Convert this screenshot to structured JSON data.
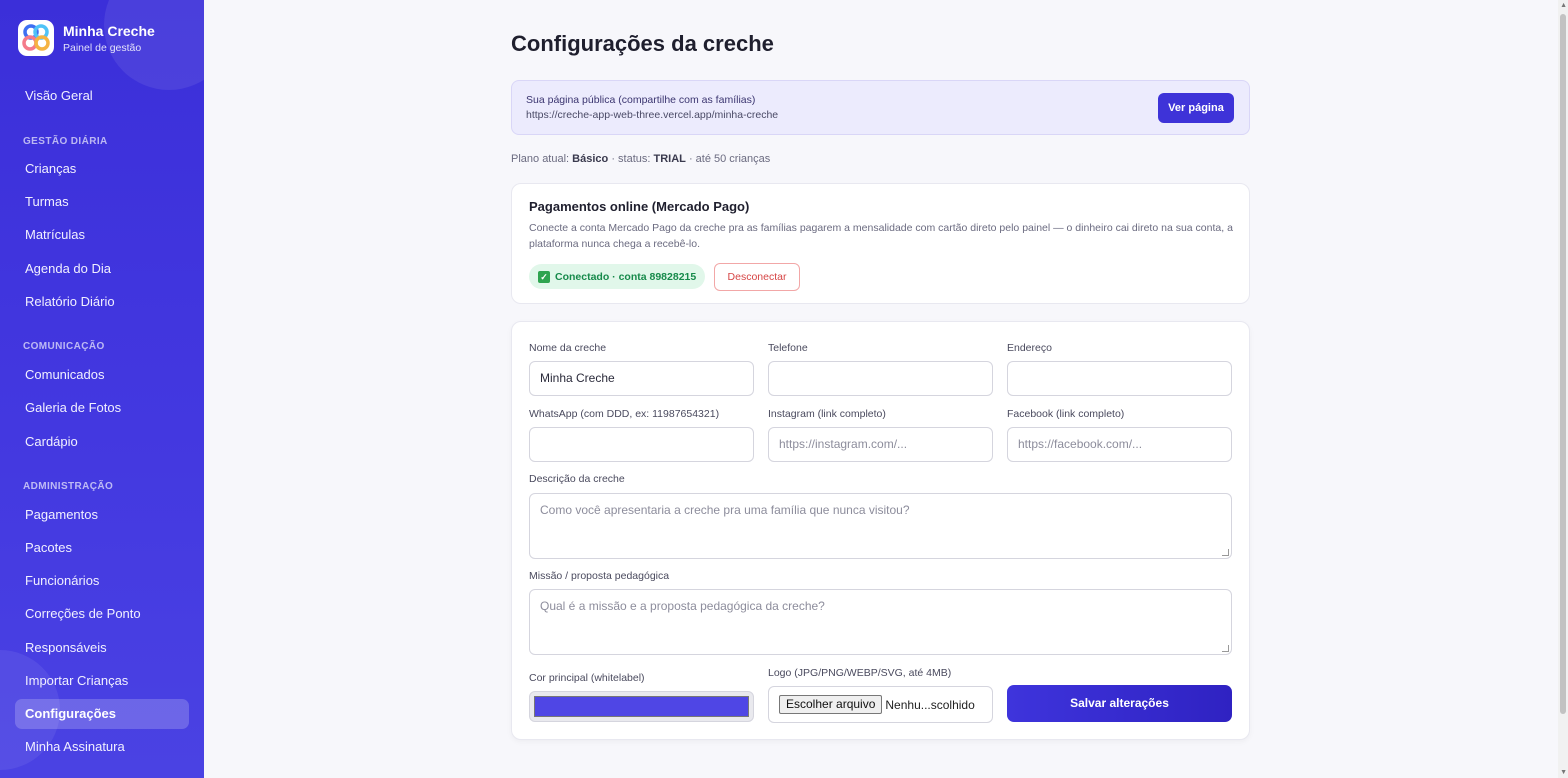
{
  "brand": {
    "name": "Minha Creche",
    "subtitle": "Painel de gestão"
  },
  "nav": {
    "overview": "Visão Geral",
    "section_daily": "GESTÃO DIÁRIA",
    "criancas": "Crianças",
    "turmas": "Turmas",
    "matriculas": "Matrículas",
    "agenda": "Agenda do Dia",
    "relatorio": "Relatório Diário",
    "section_comm": "COMUNICAÇÃO",
    "comunicados": "Comunicados",
    "galeria": "Galeria de Fotos",
    "cardapio": "Cardápio",
    "section_admin": "ADMINISTRAÇÃO",
    "pagamentos": "Pagamentos",
    "pacotes": "Pacotes",
    "funcionarios": "Funcionários",
    "correcoes": "Correções de Ponto",
    "responsaveis": "Responsáveis",
    "importar": "Importar Crianças",
    "configuracoes": "Configurações",
    "assinatura": "Minha Assinatura"
  },
  "page": {
    "title": "Configurações da creche"
  },
  "public_page": {
    "label": "Sua página pública (compartilhe com as famílias)",
    "url": "https://creche-app-web-three.vercel.app/minha-creche",
    "button": "Ver página"
  },
  "plan": {
    "prefix": "Plano atual:",
    "name": "Básico",
    "status_prefix": "· status:",
    "status": "TRIAL",
    "limit": "· até 50 crianças"
  },
  "payments": {
    "title": "Pagamentos online (Mercado Pago)",
    "description": "Conecte a conta Mercado Pago da creche pra as famílias pagarem a mensalidade com cartão direto pelo painel — o dinheiro cai direto na sua conta, a plataforma nunca chega a recebê-lo.",
    "connected": "Conectado · conta 89828215",
    "disconnect": "Desconectar"
  },
  "form": {
    "nome_label": "Nome da creche",
    "nome_value": "Minha Creche",
    "telefone_label": "Telefone",
    "telefone_value": "",
    "endereco_label": "Endereço",
    "endereco_value": "",
    "whatsapp_label": "WhatsApp (com DDD, ex: 11987654321)",
    "whatsapp_value": "",
    "instagram_label": "Instagram (link completo)",
    "instagram_placeholder": "https://instagram.com/...",
    "facebook_label": "Facebook (link completo)",
    "facebook_placeholder": "https://facebook.com/...",
    "descricao_label": "Descrição da creche",
    "descricao_placeholder": "Como você apresentaria a creche pra uma família que nunca visitou?",
    "missao_label": "Missão / proposta pedagógica",
    "missao_placeholder": "Qual é a missão e a proposta pedagógica da creche?",
    "cor_label": "Cor principal (whitelabel)",
    "cor_value": "#4f46e5",
    "logo_label": "Logo (JPG/PNG/WEBP/SVG, até 4MB)",
    "file_button": "Escolher arquivo",
    "file_status": "Nenhu...scolhido",
    "save": "Salvar alterações"
  }
}
